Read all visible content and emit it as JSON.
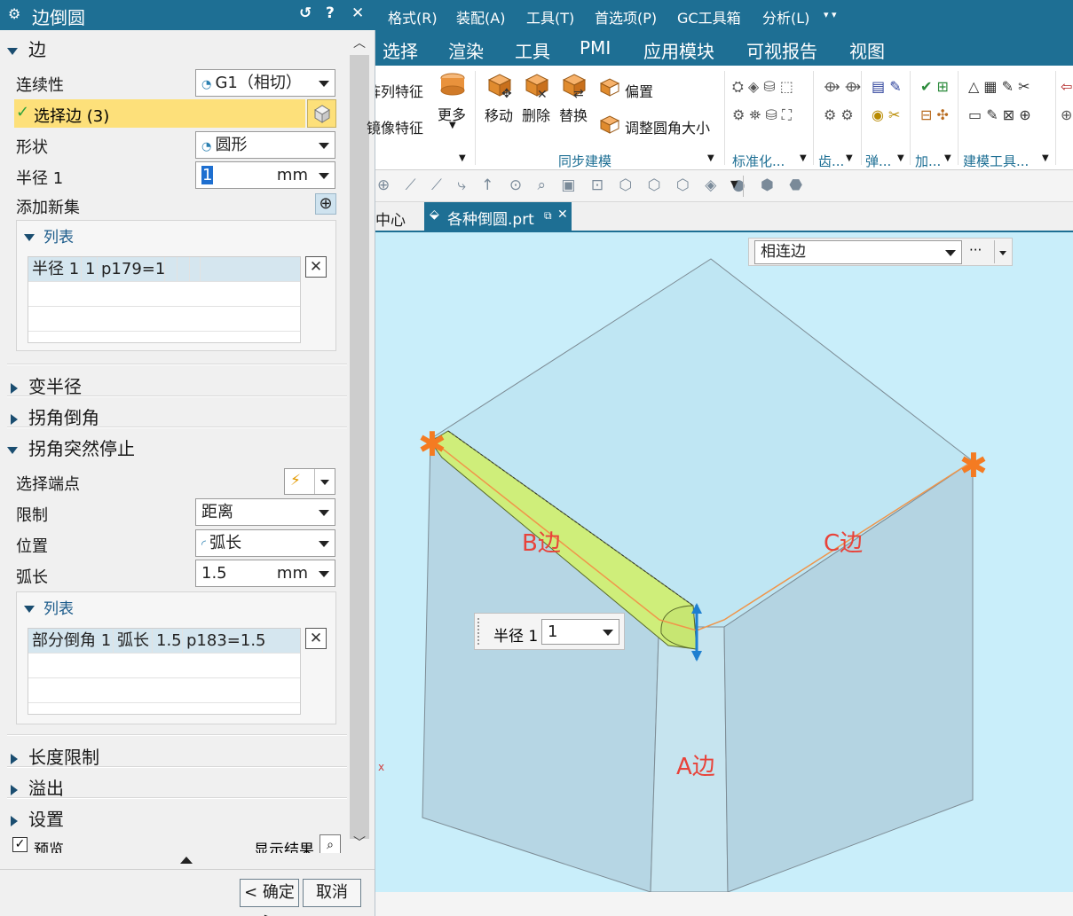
{
  "dialog": {
    "title": "边倒圆",
    "sections": {
      "edge": "边",
      "variable_radius": "变半径",
      "corner_setback": "拐角倒角",
      "corner_stop": "拐角突然停止",
      "length_limit": "长度限制",
      "overflow": "溢出",
      "settings": "设置"
    },
    "continuity": {
      "label": "连续性",
      "value": "G1（相切）"
    },
    "select_edge": "选择边 (3)",
    "shape": {
      "label": "形状",
      "value": "圆形"
    },
    "radius": {
      "label": "半径 1",
      "value": "1",
      "unit": "mm"
    },
    "add_set": "添加新集",
    "list_label": "列表",
    "list1": {
      "cells": [
        "半径 1",
        "1",
        "p179=1"
      ]
    },
    "select_endpoint": "选择端点",
    "limit": {
      "label": "限制",
      "value": "距离"
    },
    "position": {
      "label": "位置",
      "value": "弧长"
    },
    "arc_length": {
      "label": "弧长",
      "value": "1.5",
      "unit": "mm"
    },
    "list2": {
      "cells": [
        "部分倒角 1",
        "弧长",
        "1.5",
        "p183=1.5"
      ]
    },
    "preview": "预览",
    "show_result": "显示结果",
    "ok": "< 确定 >",
    "cancel": "取消"
  },
  "menu": [
    "格式(R)",
    "装配(A)",
    "工具(T)",
    "首选项(P)",
    "GC工具箱",
    "分析(L)"
  ],
  "tabs": [
    "选择",
    "渲染",
    "工具",
    "PMI",
    "应用模块",
    "可视报告",
    "视图"
  ],
  "ribbon": {
    "array_feature": "阵列特征",
    "mirror_feature": "镜像特征",
    "more": "更多",
    "move": "移动",
    "delete": "删除",
    "replace": "替换",
    "offset": "偏置",
    "resize_blend": "调整圆角大小",
    "sync_modeling": "同步建模",
    "standardize": "标准化...",
    "gear": "齿...",
    "spring": "弹...",
    "add": "加...",
    "build_tools": "建模工具..."
  },
  "doc_tabs": {
    "home": "中心",
    "part": "各种倒圆.prt"
  },
  "viewport": {
    "filter": "相连边",
    "more": "···",
    "radius_popup_label": "半径 1",
    "radius_popup_value": "1",
    "label_b": "B边",
    "label_c": "C边",
    "label_a": "A边"
  },
  "colors": {
    "title_bar": "#1e6f94",
    "highlight": "#fde07a",
    "viewport_bg": "#c9eefa",
    "blend": "#cfee7a",
    "edge_label": "#e8433a",
    "endpoint": "#f47b22"
  }
}
